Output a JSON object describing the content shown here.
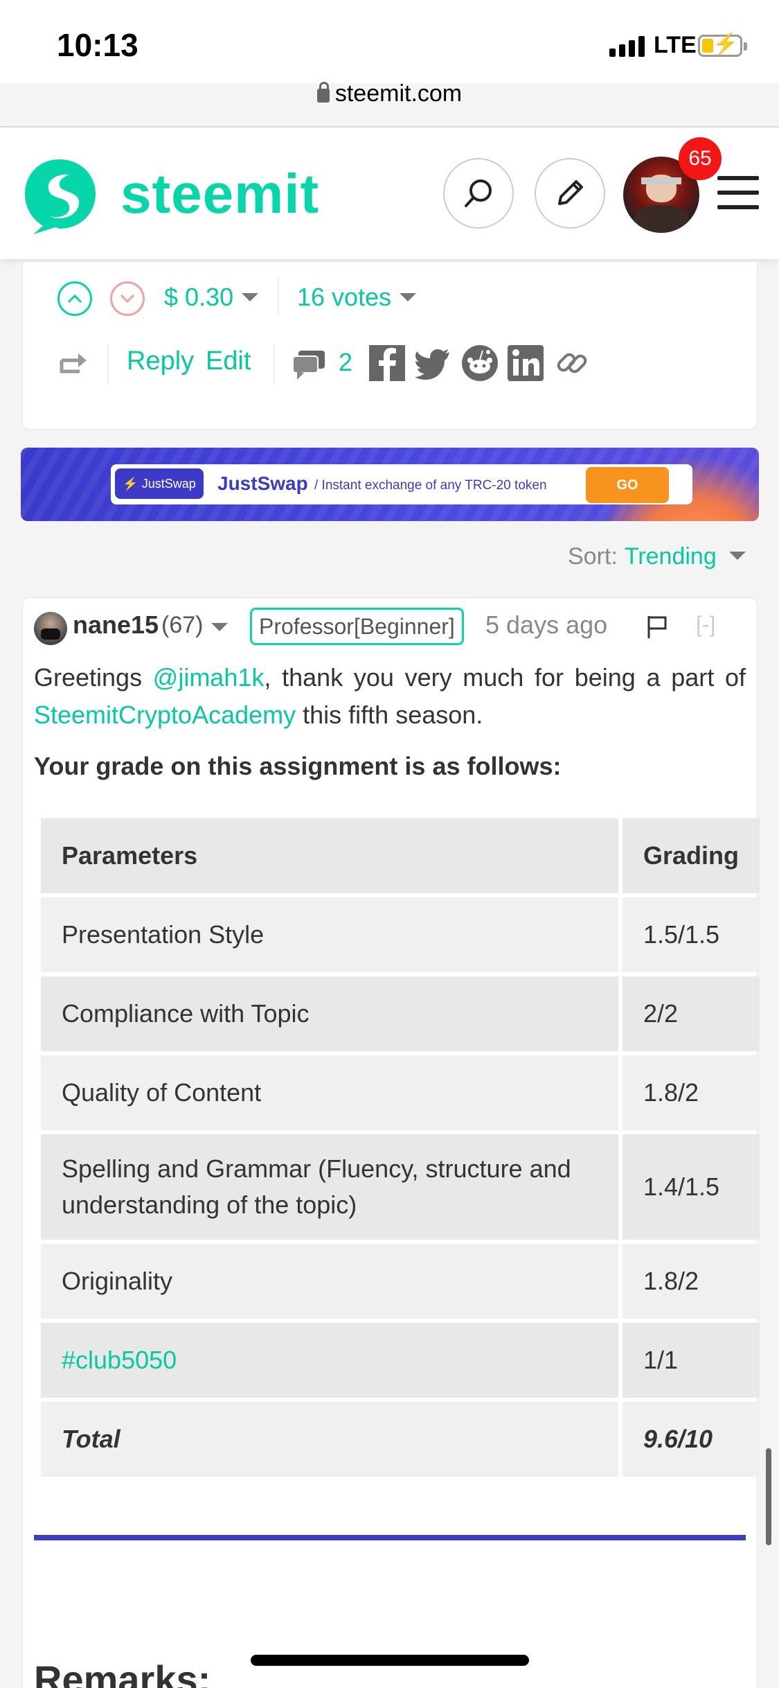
{
  "status": {
    "time": "10:13",
    "network": "LTE"
  },
  "browser": {
    "url": "steemit.com"
  },
  "header": {
    "brand": "steemit",
    "notifications": "65"
  },
  "post_actions": {
    "payout": "$ 0.30",
    "votes": "16 votes",
    "reply": "Reply",
    "edit": "Edit",
    "comments": "2"
  },
  "banner": {
    "tag": "JustSwap",
    "title": "JustSwap",
    "subtitle": "/ Instant exchange of any TRC-20 token",
    "cta": "GO"
  },
  "sort": {
    "label": "Sort:",
    "value": "Trending"
  },
  "comment": {
    "author": "nane15",
    "reputation": "(67)",
    "title": "Professor[Beginner]",
    "time": "5 days ago",
    "collapse": "[-]",
    "greeting_start": "Greetings ",
    "mention": "@jimah1k",
    "greeting_mid": ", thank you very much for being a part of ",
    "community": "SteemitCryptoAcademy",
    "greeting_end": " this fifth season.",
    "grade_intro": "Your grade on this assignment is as follows:",
    "table": {
      "headers": [
        "Parameters",
        "Grading"
      ],
      "rows": [
        [
          "Presentation Style",
          "1.5/1.5"
        ],
        [
          "Compliance with Topic",
          "2/2"
        ],
        [
          "Quality of Content",
          "1.8/2"
        ],
        [
          "Spelling and Grammar (Fluency, structure and understanding of the topic)",
          "1.4/1.5"
        ],
        [
          "Originality",
          "1.8/2"
        ],
        [
          "#club5050",
          "1/1"
        ],
        [
          "Total",
          "9.6/10"
        ]
      ]
    },
    "remarks": "Remarks:"
  },
  "colors": {
    "accent": "#06d6a9",
    "link": "#06c99f",
    "badge": "#f41515",
    "rule": "#3f3fbf"
  }
}
